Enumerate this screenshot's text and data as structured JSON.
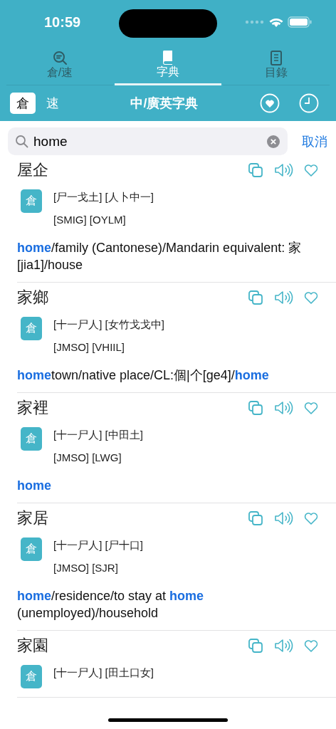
{
  "status_bar": {
    "time": "10:59"
  },
  "tabs": [
    {
      "label": "倉/速",
      "selected": false
    },
    {
      "label": "字典",
      "selected": true
    },
    {
      "label": "目錄",
      "selected": false
    }
  ],
  "mode_toggle": [
    {
      "label": "倉",
      "selected": true
    },
    {
      "label": "速",
      "selected": false
    }
  ],
  "title": "中/廣英字典",
  "search": {
    "value": "home",
    "cancel": "取消"
  },
  "entries": [
    {
      "headword": "屋企",
      "badge": "倉",
      "radicals": "[尸一戈土] [人卜中一]",
      "codes": "[SMIG] [OYLM]",
      "definition": [
        {
          "text": "home",
          "highlight": true
        },
        {
          "text": "/family (Cantonese)/Mandarin equivalent: 家[jia1]/house",
          "highlight": false
        }
      ]
    },
    {
      "headword": "家鄉",
      "badge": "倉",
      "radicals": "[十一尸人] [女竹戈戈中]",
      "codes": "[JMSO] [VHIIL]",
      "definition": [
        {
          "text": "home",
          "highlight": true
        },
        {
          "text": "town/native place/CL:個|个[ge4]/",
          "highlight": false
        },
        {
          "text": "home",
          "highlight": true
        }
      ]
    },
    {
      "headword": "家裡",
      "badge": "倉",
      "radicals": "[十一尸人] [中田土]",
      "codes": "[JMSO] [LWG]",
      "definition": [
        {
          "text": "home",
          "highlight": true
        }
      ]
    },
    {
      "headword": "家居",
      "badge": "倉",
      "radicals": "[十一尸人] [尸十口]",
      "codes": "[JMSO] [SJR]",
      "definition": [
        {
          "text": "home",
          "highlight": true
        },
        {
          "text": "/residence/to stay at ",
          "highlight": false
        },
        {
          "text": "home",
          "highlight": true
        },
        {
          "text": " (unemployed)/household",
          "highlight": false
        }
      ]
    },
    {
      "headword": "家園",
      "badge": "倉",
      "radicals": "[十一尸人] [田土口女]"
    }
  ]
}
